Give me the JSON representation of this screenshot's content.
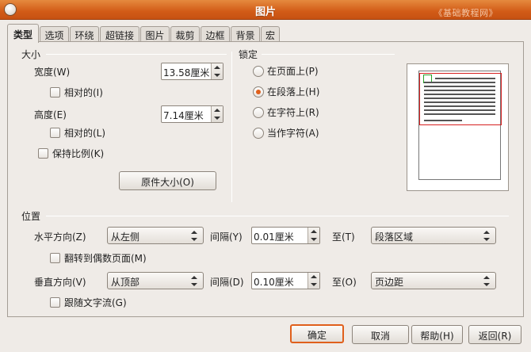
{
  "window": {
    "title": "图片",
    "watermark": "《基础教程网》"
  },
  "tabs": [
    {
      "label": "类型",
      "active": true
    },
    {
      "label": "选项",
      "active": false
    },
    {
      "label": "环绕",
      "active": false
    },
    {
      "label": "超链接",
      "active": false
    },
    {
      "label": "图片",
      "active": false
    },
    {
      "label": "裁剪",
      "active": false
    },
    {
      "label": "边框",
      "active": false
    },
    {
      "label": "背景",
      "active": false
    },
    {
      "label": "宏",
      "active": false
    }
  ],
  "size": {
    "title": "大小",
    "width_label": "宽度(W)",
    "width_value": "13.58厘米",
    "width_relative_label": "相对的(I)",
    "width_relative_checked": false,
    "height_label": "高度(E)",
    "height_value": "7.14厘米",
    "height_relative_label": "相对的(L)",
    "height_relative_checked": false,
    "keep_ratio_label": "保持比例(K)",
    "keep_ratio_checked": false,
    "original_size_button": "原件大小(O)"
  },
  "anchor": {
    "title": "锁定",
    "options": [
      {
        "label": "在页面上(P)",
        "selected": false
      },
      {
        "label": "在段落上(H)",
        "selected": true
      },
      {
        "label": "在字符上(R)",
        "selected": false
      },
      {
        "label": "当作字符(A)",
        "selected": false
      }
    ]
  },
  "position": {
    "title": "位置",
    "horizontal_label": "水平方向(Z)",
    "horizontal_value": "从左侧",
    "h_spacing_label": "间隔(Y)",
    "h_spacing_value": "0.01厘米",
    "h_to_label": "至(T)",
    "h_to_value": "段落区域",
    "mirror_label": "翻转到偶数页面(M)",
    "mirror_checked": false,
    "vertical_label": "垂直方向(V)",
    "vertical_value": "从顶部",
    "v_spacing_label": "间隔(D)",
    "v_spacing_value": "0.10厘米",
    "v_to_label": "至(O)",
    "v_to_value": "页边距",
    "follow_text_label": "跟随文字流(G)",
    "follow_text_checked": false
  },
  "buttons": {
    "ok": "确定",
    "cancel": "取消",
    "help": "帮助(H)",
    "reset": "返回(R)"
  },
  "colors": {
    "titlebar": "#d25b17",
    "accent": "#e0601c",
    "preview_frame": "#d62020",
    "anchor_marker": "#2aa12a"
  }
}
